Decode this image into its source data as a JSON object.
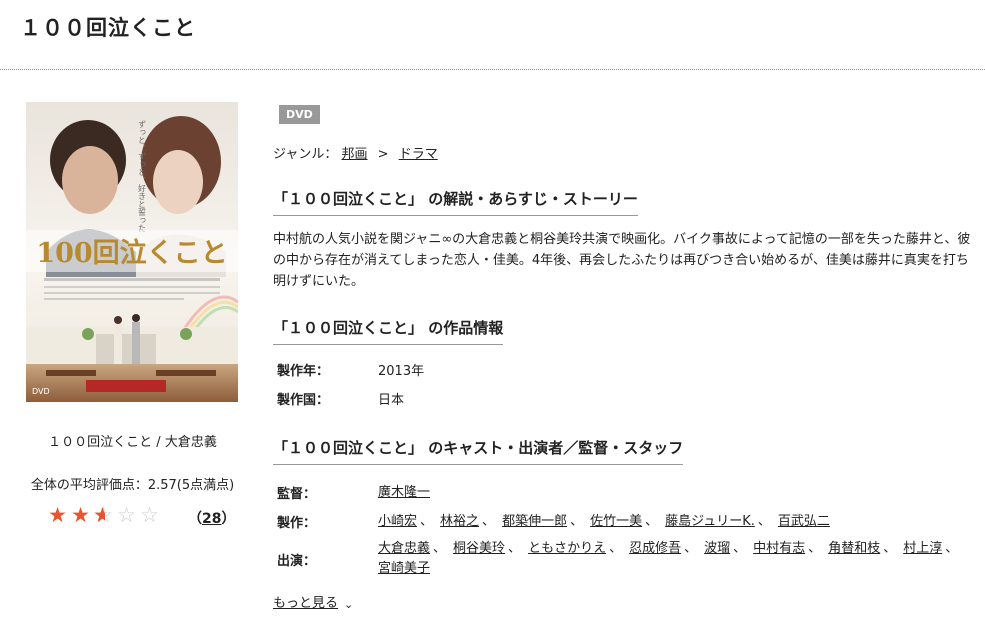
{
  "page": {
    "title": "１００回泣くこと"
  },
  "sidebar": {
    "poster_title_text": "100回泣くこと",
    "poster_tagline": "ずっと、ずっと、好きと誓った",
    "caption": "１００回泣くこと / 大倉忠義",
    "average_label": "全体の平均評価点：2.57(5点満点)",
    "rating_value": 2.57,
    "rating_max": 5,
    "review_count": "28",
    "review_count_display": "（28）"
  },
  "main": {
    "format_badge": "DVD",
    "genre": {
      "label": "ジャンル：",
      "items": [
        "邦画",
        "ドラマ"
      ],
      "separator": ">"
    },
    "synopsis_title": "「１００回泣くこと」 の解説・あらすじ・ストーリー",
    "synopsis": "中村航の人気小説を関ジャニ∞の大倉忠義と桐谷美玲共演で映画化。バイク事故によって記憶の一部を失った藤井と、彼の中から存在が消えてしまった恋人・佳美。4年後、再会したふたりは再びつき合い始めるが、佳美は藤井に真実を打ち明けずにいた。",
    "info_title": "「１００回泣くこと」 の作品情報",
    "info": [
      {
        "key": "製作年：",
        "value": "2013年"
      },
      {
        "key": "製作国：",
        "value": "日本"
      }
    ],
    "cast_title": "「１００回泣くこと」 のキャスト・出演者／監督・スタッフ",
    "cast": {
      "director_label": "監督：",
      "directors": [
        "廣木隆一"
      ],
      "producer_label": "製作：",
      "producers": [
        "小崎宏",
        "林裕之",
        "都築伸一郎",
        "佐竹一美",
        "藤島ジュリーK.",
        "百武弘二"
      ],
      "actor_label": "出演：",
      "actors": [
        "大倉忠義",
        "桐谷美玲",
        "ともさかりえ",
        "忍成修吾",
        "波瑠",
        "中村有志",
        "角替和枝",
        "村上淳",
        "宮崎美子"
      ],
      "separator": "、"
    },
    "more_label": "もっと見る"
  },
  "colors": {
    "star_filled": "#e8542c",
    "star_empty": "#cccccc",
    "badge_bg": "#999999"
  }
}
